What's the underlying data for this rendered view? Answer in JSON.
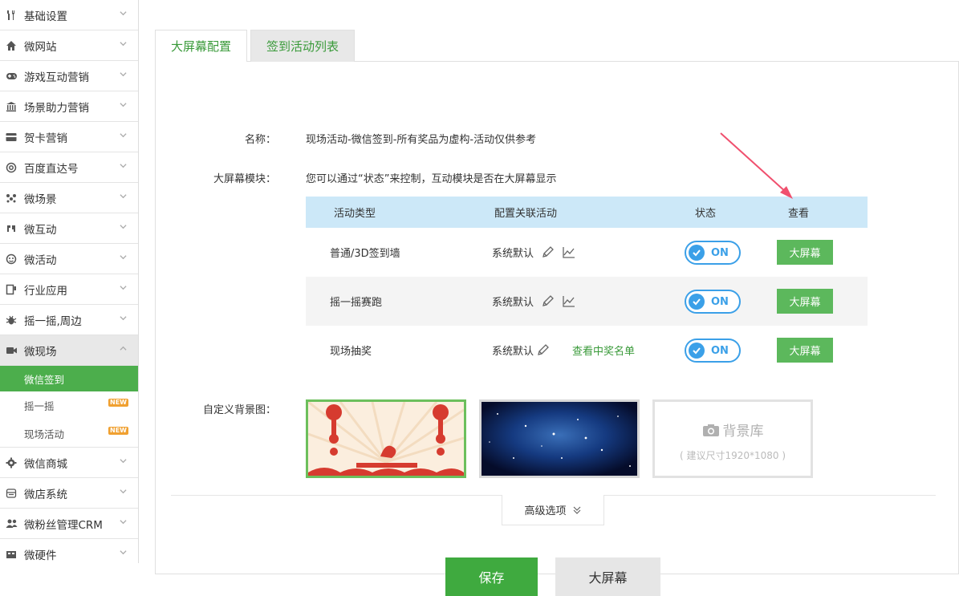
{
  "sidebar": {
    "items": [
      {
        "label": "基础设置",
        "icon": "wrench-icon"
      },
      {
        "label": "微网站",
        "icon": "home-icon"
      },
      {
        "label": "游戏互动营销",
        "icon": "gamepad-icon"
      },
      {
        "label": "场景助力营销",
        "icon": "bank-icon"
      },
      {
        "label": "贺卡营销",
        "icon": "card-icon"
      },
      {
        "label": "百度直达号",
        "icon": "at-icon"
      },
      {
        "label": "微场景",
        "icon": "scene-icon"
      },
      {
        "label": "微互动",
        "icon": "interact-icon"
      },
      {
        "label": "微活动",
        "icon": "activity-icon"
      },
      {
        "label": "行业应用",
        "icon": "app-icon"
      },
      {
        "label": "摇一摇,周边",
        "icon": "bug-icon"
      },
      {
        "label": "微现场",
        "icon": "video-icon"
      }
    ],
    "subitems": [
      {
        "label": "微信签到",
        "badge": ""
      },
      {
        "label": "摇一摇",
        "badge": "NEW"
      },
      {
        "label": "现场活动",
        "badge": "NEW"
      }
    ],
    "items_after": [
      {
        "label": "微信商城",
        "icon": "gear-icon"
      },
      {
        "label": "微店系统",
        "icon": "store-icon"
      },
      {
        "label": "微粉丝管理CRM",
        "icon": "users-icon"
      },
      {
        "label": "微硬件",
        "icon": "hardware-icon"
      }
    ]
  },
  "tabs": {
    "config": "大屏幕配置",
    "list": "签到活动列表"
  },
  "form": {
    "name_label": "名称：",
    "name_value": "现场活动-微信签到-所有奖品为虚构-活动仅供参考",
    "module_label": "大屏幕模块：",
    "module_hint": "您可以通过“状态”来控制，互动模块是否在大屏幕显示",
    "bg_label": "自定义背景图："
  },
  "table": {
    "headers": {
      "type": "活动类型",
      "config": "配置关联活动",
      "status": "状态",
      "view": "查看"
    },
    "rows": [
      {
        "type": "普通/3D签到墙",
        "config": "系统默认",
        "status": "ON",
        "button": "大屏幕",
        "link": ""
      },
      {
        "type": "摇一摇赛跑",
        "config": "系统默认",
        "status": "ON",
        "button": "大屏幕",
        "link": ""
      },
      {
        "type": "现场抽奖",
        "config": "系统默认",
        "status": "ON",
        "button": "大屏幕",
        "link": "查看中奖名单"
      }
    ]
  },
  "background": {
    "library_title": "背景库",
    "library_hint": "( 建议尺寸1920*1080 )"
  },
  "advanced": "高级选项",
  "buttons": {
    "save": "保存",
    "big_screen": "大屏幕"
  },
  "colors": {
    "accent_green": "#5cb85c",
    "toggle_blue": "#3ba0e8",
    "table_header": "#cce8f8"
  }
}
